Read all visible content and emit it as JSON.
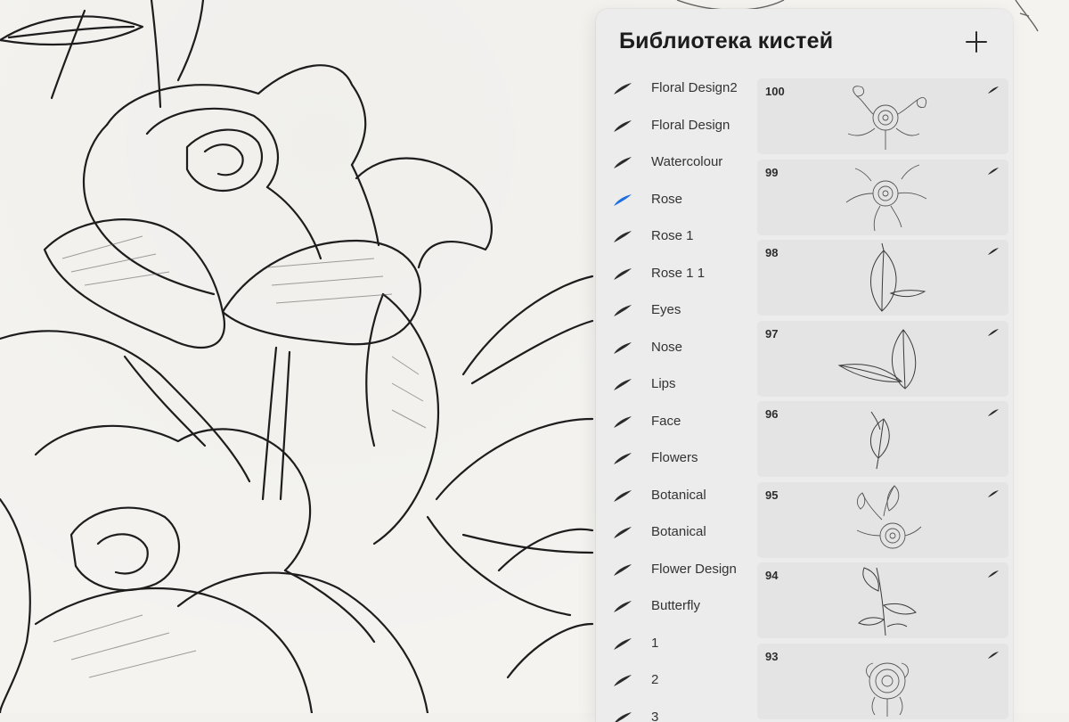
{
  "panel": {
    "title": "Библиотека кистей"
  },
  "colors": {
    "accent": "#1f6fe0",
    "icon": "#2a2a2a",
    "panel_bg": "#ececec",
    "card_bg": "#e4e4e4"
  },
  "brush_sets": [
    {
      "label": "Floral Design2",
      "icon": "brush-stroke-icon",
      "selected": false
    },
    {
      "label": "Floral Design",
      "icon": "brush-stroke-icon",
      "selected": false
    },
    {
      "label": "Watercolour",
      "icon": "brush-stroke-icon",
      "selected": false
    },
    {
      "label": "Rose",
      "icon": "brush-stroke-icon",
      "selected": true
    },
    {
      "label": "Rose 1",
      "icon": "brush-stroke-icon",
      "selected": false
    },
    {
      "label": "Rose 1 1",
      "icon": "brush-stroke-icon",
      "selected": false
    },
    {
      "label": "Eyes",
      "icon": "brush-stroke-icon",
      "selected": false
    },
    {
      "label": "Nose",
      "icon": "brush-stroke-icon",
      "selected": false
    },
    {
      "label": "Lips",
      "icon": "brush-stroke-icon",
      "selected": false
    },
    {
      "label": "Face",
      "icon": "brush-stroke-icon",
      "selected": false
    },
    {
      "label": "Flowers",
      "icon": "brush-stroke-icon",
      "selected": false
    },
    {
      "label": "Botanical",
      "icon": "brush-stroke-icon",
      "selected": false
    },
    {
      "label": "Botanical",
      "icon": "brush-stroke-icon",
      "selected": false
    },
    {
      "label": "Flower Design",
      "icon": "brush-stroke-icon",
      "selected": false
    },
    {
      "label": "Butterfly",
      "icon": "brush-stroke-icon",
      "selected": false
    },
    {
      "label": "1",
      "icon": "brush-stroke-icon",
      "selected": false
    },
    {
      "label": "2",
      "icon": "brush-stroke-icon",
      "selected": false
    },
    {
      "label": "3",
      "icon": "brush-stroke-icon",
      "selected": false
    }
  ],
  "brushes": [
    {
      "number": "100",
      "preview": "peony-bouquet"
    },
    {
      "number": "99",
      "preview": "peony-leaves"
    },
    {
      "number": "98",
      "preview": "leaf-pair"
    },
    {
      "number": "97",
      "preview": "leaf-pair-wide"
    },
    {
      "number": "96",
      "preview": "single-leaf"
    },
    {
      "number": "95",
      "preview": "peony-bouquet"
    },
    {
      "number": "94",
      "preview": "leaf-stem"
    },
    {
      "number": "93",
      "preview": "peony-single"
    }
  ]
}
